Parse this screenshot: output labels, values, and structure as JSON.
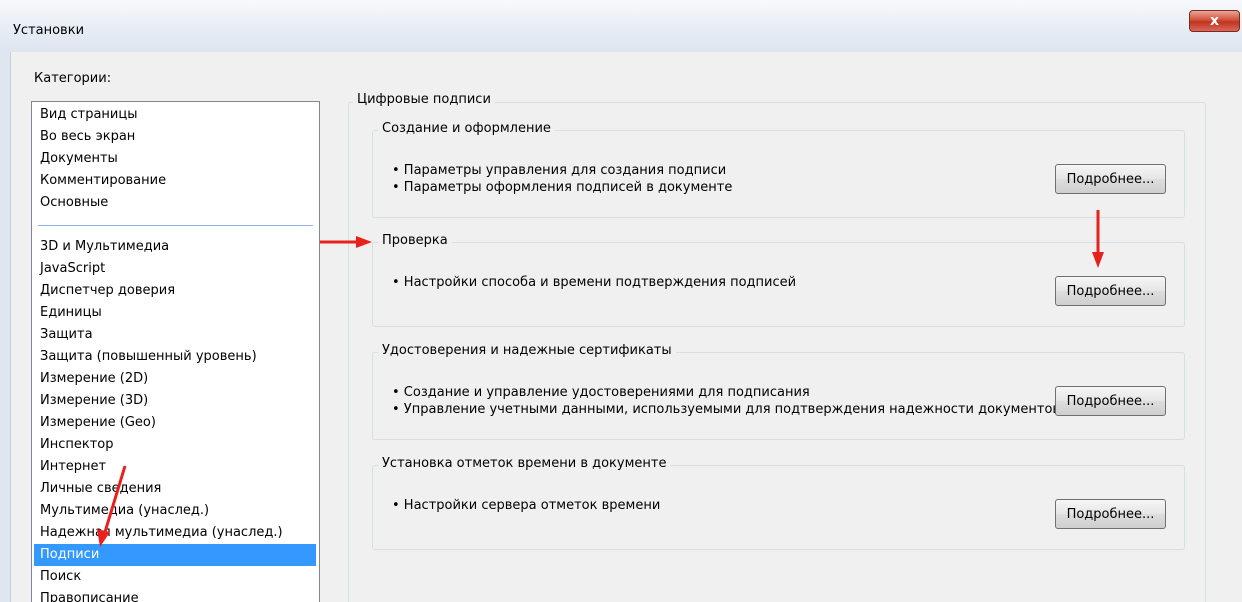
{
  "window": {
    "title": "Установки",
    "close_glyph": "x"
  },
  "categories": {
    "label": "Категории:",
    "top_items": [
      "Вид страницы",
      "Во весь экран",
      "Документы",
      "Комментирование",
      "Основные"
    ],
    "items": [
      "3D и Мультимедиа",
      "JavaScript",
      "Диспетчер доверия",
      "Единицы",
      "Защита",
      "Защита (повышенный уровень)",
      "Измерение (2D)",
      "Измерение (3D)",
      "Измерение (Geo)",
      "Инспектор",
      "Интернет",
      "Личные сведения",
      "Мультимедиа (унаслед.)",
      "Надежная мультимедиа (унаслед.)",
      "Подписи",
      "Поиск",
      "Правописание"
    ],
    "selected": "Подписи"
  },
  "main": {
    "title": "Цифровые подписи",
    "groups": [
      {
        "title": "Создание и оформление",
        "lines": [
          "• Параметры управления для создания подписи",
          "• Параметры оформления подписей в документе"
        ],
        "button": "Подробнее..."
      },
      {
        "title": "Проверка",
        "lines": [
          "• Настройки способа и времени подтверждения подписей"
        ],
        "button": "Подробнее..."
      },
      {
        "title": "Удостоверения и надежные сертификаты",
        "lines": [
          "• Создание и управление удостоверениями для подписания",
          "• Управление учетными данными, используемыми для подтверждения надежности документов"
        ],
        "button": "Подробнее..."
      },
      {
        "title": "Установка отметок времени в документе",
        "lines": [
          "• Настройки сервера отметок времени"
        ],
        "button": "Подробнее..."
      }
    ]
  },
  "annotations": {
    "arrow_color": "#e8211c"
  },
  "colors": {
    "selection": "#3399ff",
    "close_button": "#c9452f"
  }
}
